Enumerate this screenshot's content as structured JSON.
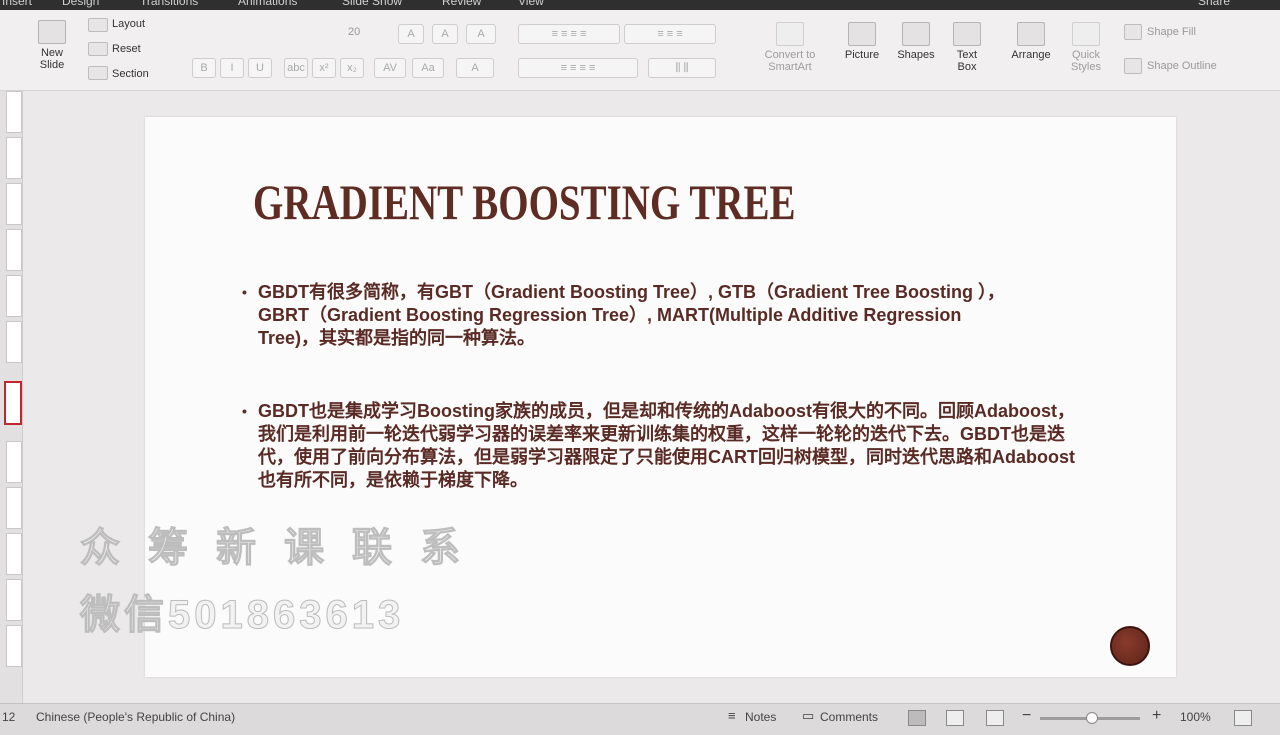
{
  "menu": {
    "tabs": [
      "Insert",
      "Design",
      "Transitions",
      "Animations",
      "Slide Show",
      "Review",
      "View"
    ],
    "share": "Share"
  },
  "ribbon": {
    "new_slide": "New\nSlide",
    "layout": "Layout",
    "reset": "Reset",
    "section": "Section",
    "font_size": "20",
    "convert_smartart": "Convert to\nSmartArt",
    "picture": "Picture",
    "shapes": "Shapes",
    "text_box": "Text\nBox",
    "arrange": "Arrange",
    "quick_styles": "Quick\nStyles",
    "shape_fill": "Shape Fill",
    "shape_outline": "Shape Outline"
  },
  "slide": {
    "title": "GRADIENT BOOSTING TREE",
    "bullet1": "GBDT有很多简称，有GBT（Gradient Boosting Tree）, GTB（Gradient Tree Boosting ）， GBRT（Gradient Boosting Regression Tree）, MART(Multiple Additive Regression Tree)，其实都是指的同一种算法。",
    "bullet2": "GBDT也是集成学习Boosting家族的成员，但是却和传统的Adaboost有很大的不同。回顾Adaboost，我们是利用前一轮迭代弱学习器的误差率来更新训练集的权重，这样一轮轮的迭代下去。GBDT也是迭代，使用了前向分布算法，但是弱学习器限定了只能使用CART回归树模型，同时迭代思路和Adaboost也有所不同，是依赖于梯度下降。"
  },
  "watermark": {
    "line1": "众筹新课联系",
    "line2": "微信501863613"
  },
  "status": {
    "slide_num": "12",
    "language": "Chinese (People's Republic of China)",
    "notes": "Notes",
    "comments": "Comments",
    "zoom": "100%"
  },
  "colors": {
    "title": "#5e2c22",
    "body_text": "#5a2a24",
    "selected_thumb": "#c1272d"
  }
}
